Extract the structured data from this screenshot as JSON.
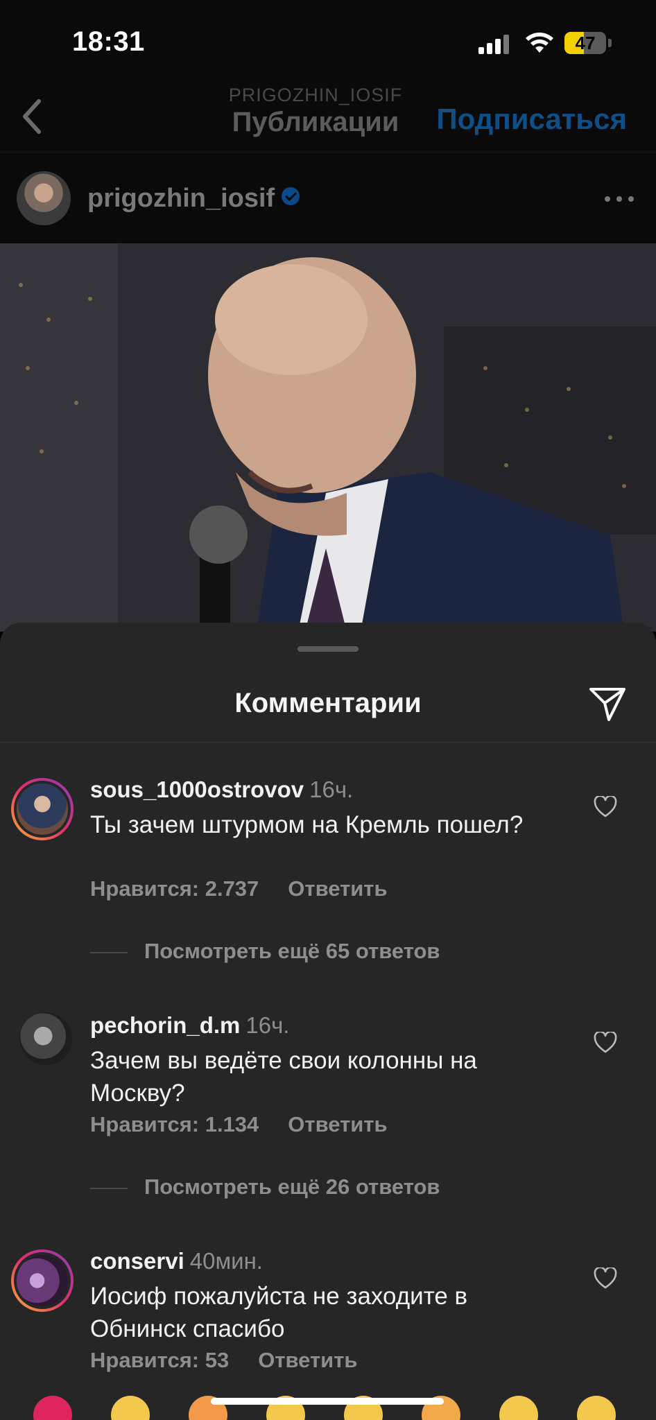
{
  "status_bar": {
    "time": "18:31",
    "battery": "47",
    "battery_level": 0.47
  },
  "nav": {
    "subtitle": "PRIGOZHIN_IOSIF",
    "title": "Публикации",
    "subscribe_label": "Подписаться"
  },
  "post": {
    "username": "prigozhin_iosif",
    "verified": true
  },
  "sheet": {
    "title": "Комментарии"
  },
  "comments": [
    {
      "username": "sous_1000ostrovov",
      "time": "16ч.",
      "text": "Ты зачем штурмом на Кремль пошел?",
      "likes": "Нравится: 2.737",
      "reply": "Ответить",
      "more_replies": "Посмотреть ещё 65 ответов"
    },
    {
      "username": "pechorin_d.m",
      "time": "16ч.",
      "text": "Зачем вы ведёте свои колонны на Москву?",
      "likes": "Нравится: 1.134",
      "reply": "Ответить",
      "more_replies": "Посмотреть ещё 26 ответов"
    },
    {
      "username": "conservi",
      "time": "40мин.",
      "text": "Иосиф пожалуйста не заходите в Обнинск спасибо",
      "likes": "Нравится: 53",
      "reply": "Ответить"
    }
  ],
  "emoji_bar": [
    "heart-emoji",
    "raised-hands-emoji",
    "fire-emoji",
    "clap-emoji",
    "crying-emoji",
    "heart-eyes-emoji",
    "surprised-emoji",
    "laughing-emoji"
  ],
  "colors": {
    "accent": "#0d4f86",
    "sheet_bg": "#262626",
    "secondary_text": "#8e8e8e"
  }
}
